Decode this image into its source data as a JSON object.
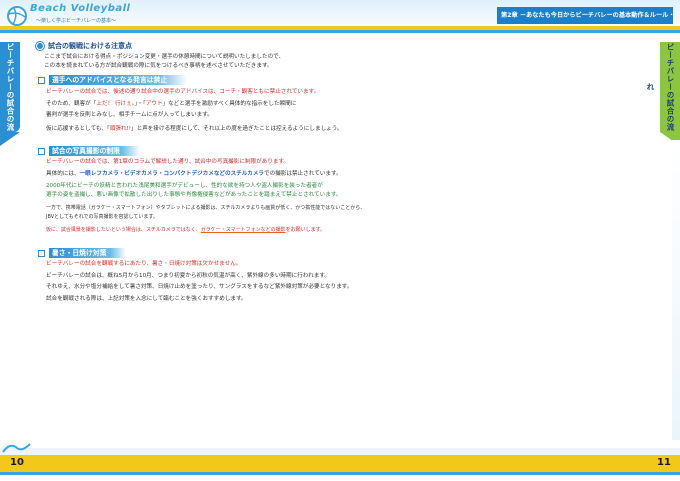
{
  "header": {
    "logo_text": "Beach Volleyball",
    "logo_sub": "～楽しく学ぶビーチバレーの基本～",
    "chapter_label": "第2章 －あなたも今日からビーチバレーの基本動作＆ルール・サイン"
  },
  "side_tabs": {
    "left": "ビーチバレーの試合の流れ",
    "right": "ビーチバレーの試合の流れ"
  },
  "section1": {
    "title": "試合の観戦における注意点",
    "intro": [
      "ここまで試合における得点・ポジション変更・選手の休憩時間について説明いたしましたので、",
      "この本を読まれている方が試合観戦の際に気をつけるべき事柄を述べさせていただきます。"
    ]
  },
  "sub1": {
    "title": "選手へのアドバイスとなる発言は禁止",
    "l1a": "ビーチバレーの試合では、後述の通り試合中の選手のアドバイスは、コーチ・観客ともに禁止されています。",
    "l2a": "そのため、観客が「",
    "l2b": "上だ！ 行けぇ。",
    "l2c": "」・「",
    "l2d": "アウト",
    "l2e": "」などと選手を激励すべく具体的な指示をした瞬間に",
    "l3": "審判が選手を反則とみなし、相手チームに点が入ってしまいます。",
    "l4a": "仮に応援するとしても、「",
    "l4b": "頑張れ!!",
    "l4c": "」と声を掛ける程度にして、それ以上の度を過ぎたことは控えるようにしましょう。"
  },
  "sub2": {
    "title": "試合の写真撮影の制限",
    "l1": "ビーチバレーの試合では、第1章のコラムで解説した通り、試合中の写真撮影に制限があります。",
    "l2a": "具体的には、",
    "l2b": "一眼レフカメラ・ビデオカメラ・コンパクトデジカメなどのスチルカメラ",
    "l2c": "での撮影は禁止されています。",
    "l3": "2000年代にビーチの妖精と言われた浅尾美和選手がデビューし、性的な欲を持つ人や盗人撮影を装った者者が",
    "l4": "選手の姿を盗撮し、悪い画像で拡散した出りした事態や肖像権侵害などがあったことを踏まえて禁止とされています。",
    "l5": "一方で、携帯電話（ガラケー・スマートフォン）やタブレットによる撮影は、スチルカメラよりも画質が低く、かつ拡性能ではないことから、",
    "l6": "JBVとしてもそれでの写真撮影を容認しています。",
    "l7a": "仮に、試合風景を撮影したいという場合は、スチルカメラではなく、",
    "l7b": "ガラケー・スマートフォンなどの撮影",
    "l7c": "をお願いします。"
  },
  "sub3": {
    "title": "暑さ・日焼け対策",
    "l1": "ビーチバレーの試合を観戦するにあたり、暑さ・日焼け対策は欠かせません。",
    "l2": "ビーチバレーの試合は、概ね5月から10月、つまり初夏から初秋の気温が高く、紫外線の多い時期に行われます。",
    "l3": "それゆえ、水分や塩分補給をして暑さ対策、日焼け止めを塗ったり、サングラスをするなど紫外線対策が必要となります。",
    "l4": "試合を観戦される際は、上記対策を入念にして臨むことを強くおすすめします。"
  },
  "footer": {
    "page_left": "10",
    "page_right": "11"
  },
  "colors": {
    "accent_blue": "#2b8fd3",
    "accent_yellow": "#f2c81a",
    "accent_green": "#8cc63f",
    "emphasis_red": "#d72a2a"
  }
}
